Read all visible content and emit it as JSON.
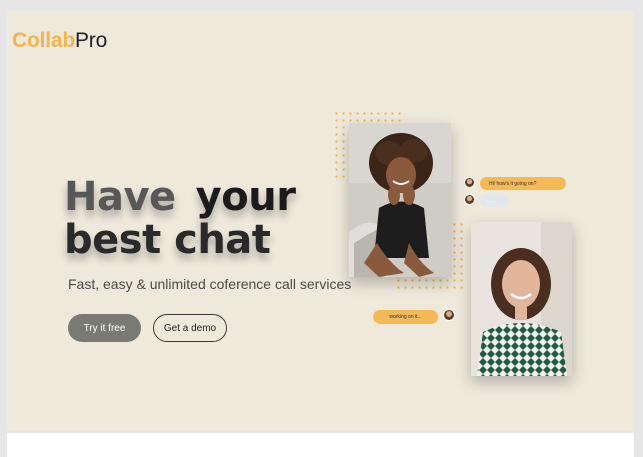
{
  "brand": {
    "part1": "Collab",
    "part2": "Pro",
    "accent_color": "#f3b44d"
  },
  "hero": {
    "headline_word1": "Have",
    "headline_word2": "your",
    "headline_line2": "best chat",
    "subtitle": "Fast, easy & unlimited coference call services",
    "primary_button": "Try it free",
    "secondary_button": "Get a demo"
  },
  "chat": {
    "message1": "Hi! how's it going on?",
    "message2": "......",
    "message3": "working on it..."
  },
  "colors": {
    "background": "#efe9dc",
    "bubble": "#f7b954",
    "button_primary": "#7a7a75"
  }
}
